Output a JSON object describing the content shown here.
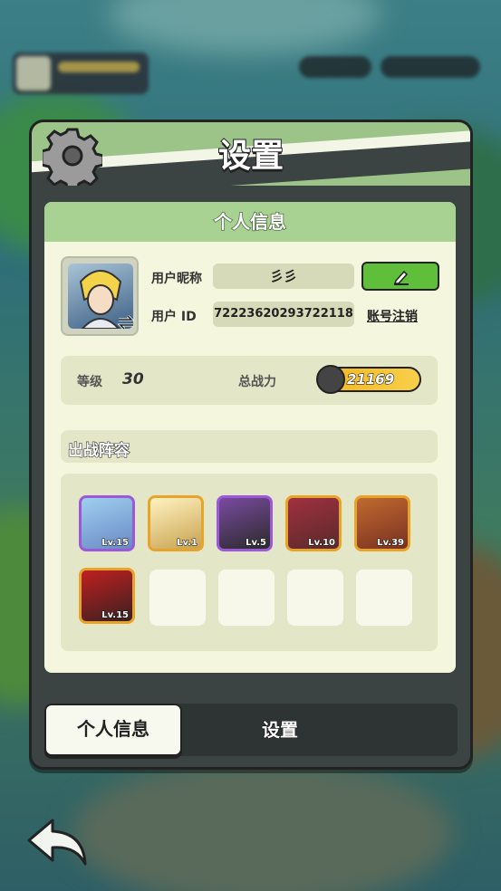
{
  "header": {
    "title": "设置"
  },
  "profile": {
    "section_title": "个人信息",
    "nickname_label": "用户昵称",
    "nickname_value": "彡彡",
    "id_label": "用户  ID",
    "id_value": "7222362029372211​8",
    "cancel_account_link": "账号注销",
    "level_label": "等级",
    "level_value": "30",
    "power_label": "总战力",
    "power_value": "21169"
  },
  "lineup": {
    "title": "出战阵容",
    "heroes": [
      {
        "level": "Lv.15",
        "frame_color": "#9b59d9"
      },
      {
        "level": "Lv.1",
        "frame_color": "#e8a32b"
      },
      {
        "level": "Lv.5",
        "frame_color": "#9b59d9"
      },
      {
        "level": "Lv.10",
        "frame_color": "#e8a32b"
      },
      {
        "level": "Lv.39",
        "frame_color": "#e8a32b"
      },
      {
        "level": "Lv.15",
        "frame_color": "#e8a32b"
      }
    ]
  },
  "tabs": {
    "active": "个人信息",
    "other": "设置"
  },
  "colors": {
    "accent_green": "#9cc488",
    "body_bg": "#f4f7dd",
    "edit_green": "#5fbf3a"
  },
  "icons": {
    "gear": "gear-icon",
    "edit": "pencil-icon",
    "back": "back-arrow-icon",
    "swap": "swap-icon"
  }
}
